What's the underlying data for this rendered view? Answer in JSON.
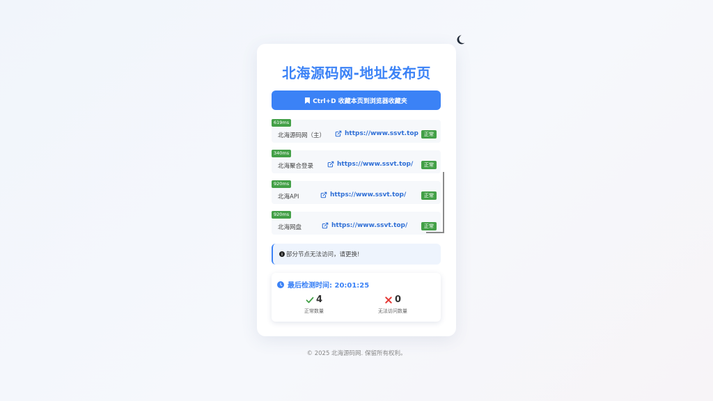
{
  "header": {
    "title": "北海源码网-地址发布页",
    "bookmark_label": "Ctrl+D 收藏本页到浏览器收藏夹"
  },
  "links": [
    {
      "latency": "619ms",
      "name": "北海源码网（主）",
      "url": "https://www.ssvt.top",
      "status": "正常"
    },
    {
      "latency": "340ms",
      "name": "北海聚合登录",
      "url": "https://www.ssvt.top/",
      "status": "正常"
    },
    {
      "latency": "920ms",
      "name": "北海API",
      "url": "https://www.ssvt.top/",
      "status": "正常"
    },
    {
      "latency": "920ms",
      "name": "北海网盘",
      "url": "https://www.ssvt.top/",
      "status": "正常"
    }
  ],
  "notice": {
    "text": "部分节点无法访问，请更换!"
  },
  "stats": {
    "last_check_label": "最后检测时间: 20:01:25",
    "ok_count": "4",
    "ok_label": "正常数量",
    "fail_count": "0",
    "fail_label": "无法访问数量"
  },
  "footer": {
    "copyright": "© 2025 北海源码网. 保留所有权利。"
  },
  "colors": {
    "accent": "#3b82f6",
    "ok": "#43a047",
    "fail": "#e53935"
  },
  "icons": {
    "theme_toggle": "moon-icon",
    "bookmark": "bookmark-icon",
    "link": "external-link-icon",
    "notice": "info-circle-icon",
    "clock": "clock-icon",
    "ok": "check-icon",
    "fail": "x-icon"
  }
}
